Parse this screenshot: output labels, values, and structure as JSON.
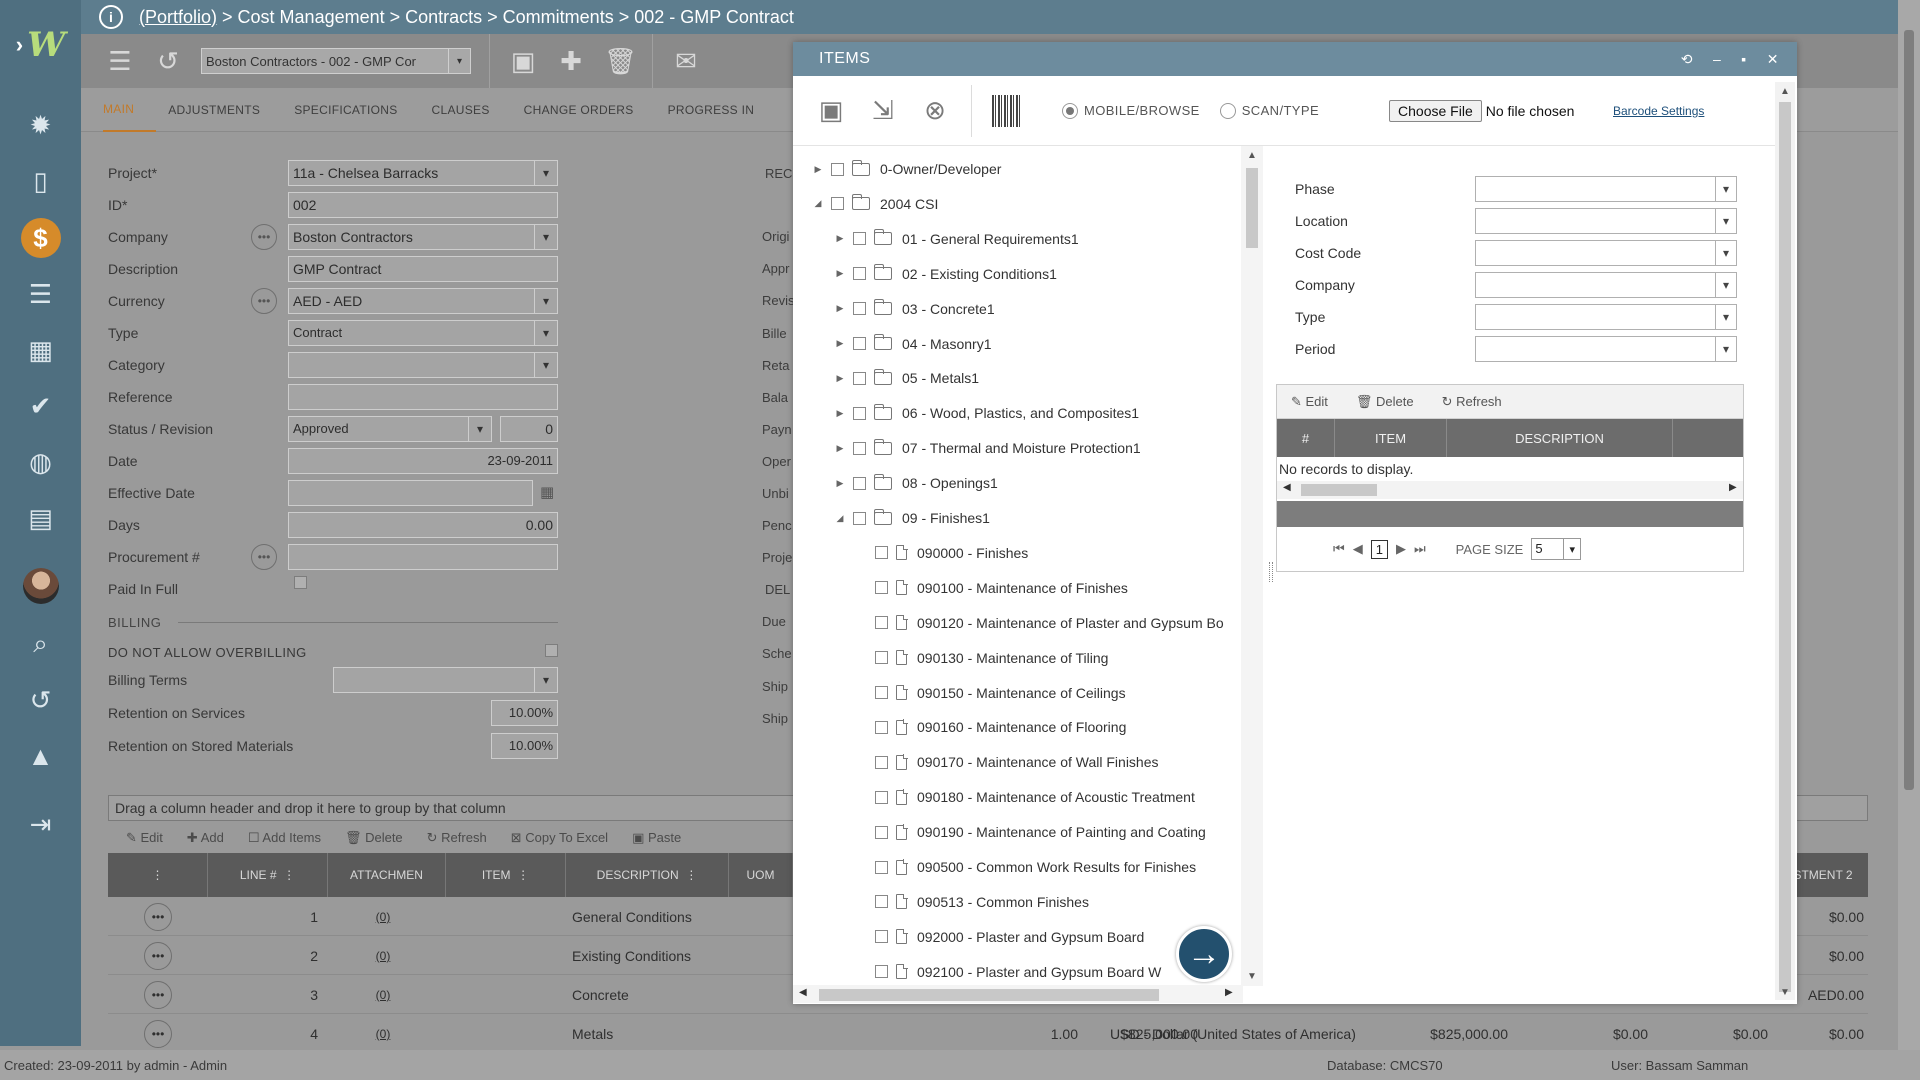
{
  "breadcrumb": {
    "portfolio": "(Portfolio)",
    "rest": " > Cost Management > Contracts > Commitments > 002 - GMP Contract"
  },
  "toolbar": {
    "contract_select": "Boston Contractors - 002 - GMP Cor"
  },
  "tabs": [
    "MAIN",
    "ADJUSTMENTS",
    "SPECIFICATIONS",
    "CLAUSES",
    "CHANGE ORDERS",
    "PROGRESS IN"
  ],
  "form": {
    "project_label": "Project*",
    "project_value": "11a - Chelsea Barracks",
    "id_label": "ID*",
    "id_value": "002",
    "company_label": "Company",
    "company_value": "Boston Contractors",
    "description_label": "Description",
    "description_value": "GMP Contract",
    "currency_label": "Currency",
    "currency_value": "AED - AED",
    "type_label": "Type",
    "type_value": "Contract",
    "category_label": "Category",
    "category_value": "",
    "reference_label": "Reference",
    "reference_value": "",
    "status_label": "Status / Revision",
    "status_value": "Approved",
    "revision_value": "0",
    "date_label": "Date",
    "date_value": "23-09-2011",
    "effective_date_label": "Effective Date",
    "effective_date_value": "",
    "days_label": "Days",
    "days_value": "0.00",
    "procurement_label": "Procurement #",
    "procurement_value": "",
    "paid_in_full_label": "Paid In Full",
    "billing_title": "BILLING",
    "no_overbilling_label": "DO NOT ALLOW OVERBILLING",
    "billing_terms_label": "Billing Terms",
    "retention_services_label": "Retention on Services",
    "retention_services_value": "10.00%",
    "retention_stored_label": "Retention on Stored Materials",
    "retention_stored_value": "10.00%"
  },
  "right_partial_labels": [
    "REC",
    "Origi",
    "Appr",
    "Revis",
    "Bille",
    "Reta",
    "Bala",
    "Payn",
    "Oper",
    "Unbi",
    "Penc",
    "Proje",
    "DEL",
    "Due",
    "Sche",
    "Ship",
    "Ship"
  ],
  "grid": {
    "group_hint": "Drag a column header and drop it here to group by that column",
    "tools": [
      "Edit",
      "Add",
      "Add Items",
      "Delete",
      "Refresh",
      "Copy To Excel",
      "Paste"
    ],
    "headers": [
      "LINE #",
      "ATTACHMEN",
      "ITEM",
      "DESCRIPTION",
      "UOM",
      "STMENT 2"
    ],
    "rows": [
      {
        "line": "1",
        "att": "(0)",
        "desc": "General Conditions",
        "last": "$0.00"
      },
      {
        "line": "2",
        "att": "(0)",
        "desc": "Existing Conditions",
        "last": "$0.00"
      },
      {
        "line": "3",
        "att": "(0)",
        "desc": "Concrete",
        "last": "AED0.00"
      },
      {
        "line": "4",
        "att": "(0)",
        "desc": "Metals",
        "qty": "1.00",
        "amount": "$825,000.00",
        "currency": "USD - Dollar (United States of America)",
        "amount2": "$825,000.00",
        "z1": "$0.00",
        "z2": "$0.00",
        "last": "$0.00"
      }
    ]
  },
  "status": {
    "created": "Created:  23-09-2011 by admin - Admin",
    "database": "Database:   CMCS70",
    "user": "User:  Bassam Samman"
  },
  "modal": {
    "title": "ITEMS",
    "mode_mobile": "MOBILE/BROWSE",
    "mode_scan": "SCAN/TYPE",
    "choose_file": "Choose File",
    "no_file": "No file chosen",
    "barcode_settings": "Barcode Settings",
    "tree": [
      {
        "label": "0-Owner/Developer",
        "level": 0,
        "kind": "folder",
        "expanded": false
      },
      {
        "label": "2004 CSI",
        "level": 0,
        "kind": "folder",
        "expanded": true
      },
      {
        "label": "01 - General Requirements1",
        "level": 1,
        "kind": "folder",
        "expanded": false
      },
      {
        "label": "02 - Existing Conditions1",
        "level": 1,
        "kind": "folder",
        "expanded": false
      },
      {
        "label": "03 - Concrete1",
        "level": 1,
        "kind": "folder",
        "expanded": false
      },
      {
        "label": "04 - Masonry1",
        "level": 1,
        "kind": "folder",
        "expanded": false
      },
      {
        "label": "05 - Metals1",
        "level": 1,
        "kind": "folder",
        "expanded": false
      },
      {
        "label": "06 - Wood, Plastics, and Composites1",
        "level": 1,
        "kind": "folder",
        "expanded": false
      },
      {
        "label": "07 - Thermal and Moisture Protection1",
        "level": 1,
        "kind": "folder",
        "expanded": false
      },
      {
        "label": "08 - Openings1",
        "level": 1,
        "kind": "folder",
        "expanded": false
      },
      {
        "label": "09 - Finishes1",
        "level": 1,
        "kind": "folder",
        "expanded": true
      },
      {
        "label": "090000 - Finishes",
        "level": 2,
        "kind": "file"
      },
      {
        "label": "090100 - Maintenance of Finishes",
        "level": 2,
        "kind": "file"
      },
      {
        "label": "090120 - Maintenance of Plaster and Gypsum Bo",
        "level": 2,
        "kind": "file"
      },
      {
        "label": "090130 - Maintenance of Tiling",
        "level": 2,
        "kind": "file"
      },
      {
        "label": "090150 - Maintenance of Ceilings",
        "level": 2,
        "kind": "file"
      },
      {
        "label": "090160 - Maintenance of Flooring",
        "level": 2,
        "kind": "file"
      },
      {
        "label": "090170 - Maintenance of Wall Finishes",
        "level": 2,
        "kind": "file"
      },
      {
        "label": "090180 - Maintenance of Acoustic Treatment",
        "level": 2,
        "kind": "file"
      },
      {
        "label": "090190 - Maintenance of Painting and Coating",
        "level": 2,
        "kind": "file"
      },
      {
        "label": "090500 - Common Work Results for Finishes",
        "level": 2,
        "kind": "file"
      },
      {
        "label": "090513 - Common Finishes",
        "level": 2,
        "kind": "file"
      },
      {
        "label": "092000 - Plaster and Gypsum Board",
        "level": 2,
        "kind": "file"
      },
      {
        "label": "092100 - Plaster and Gypsum Board W",
        "level": 2,
        "kind": "file"
      }
    ],
    "filters": [
      "Phase",
      "Location",
      "Cost Code",
      "Company",
      "Type",
      "Period"
    ],
    "subgrid": {
      "tools": [
        "Edit",
        "Delete",
        "Refresh"
      ],
      "headers": [
        "#",
        "ITEM",
        "DESCRIPTION"
      ],
      "no_records": "No records to display.",
      "page": "1",
      "page_size_label": "PAGE SIZE",
      "page_size": "5"
    }
  }
}
